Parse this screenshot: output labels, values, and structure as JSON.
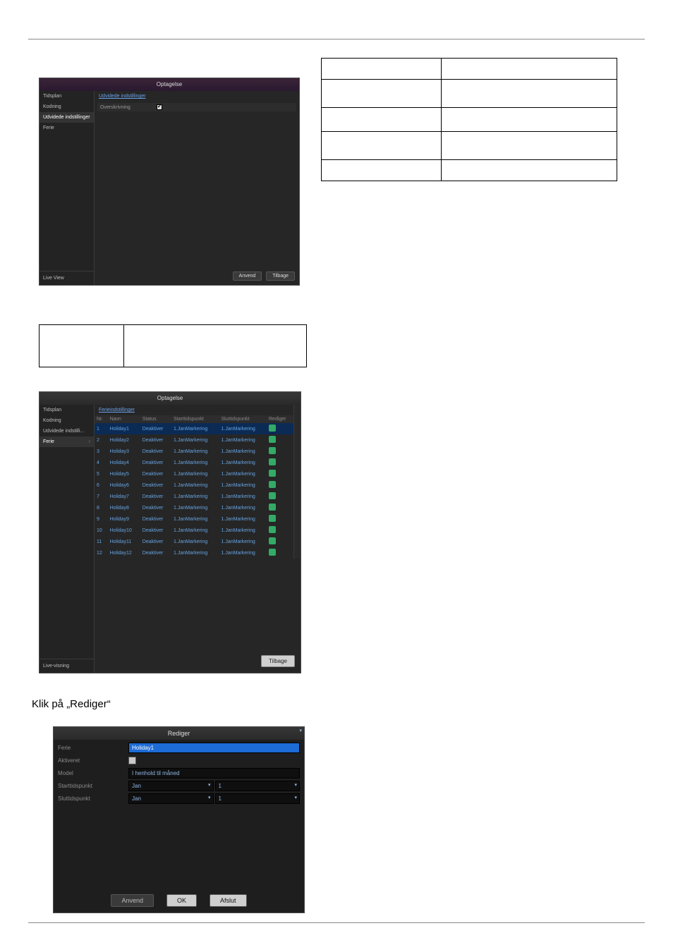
{
  "shot1": {
    "title": "Optagelse",
    "sidebar": [
      "Tidsplan",
      "Kodning",
      "Udvidede indstillinger",
      "Ferie"
    ],
    "sidebar_selected": 2,
    "live": "Live View",
    "tab": "Udvidede indstillinger",
    "row_label": "Overskrivning",
    "buttons": {
      "apply": "Anvend",
      "back": "Tilbage"
    }
  },
  "shot2": {
    "title": "Optagelse",
    "sidebar": [
      "Tidsplan",
      "Kodning",
      "Udvidede indstilli...",
      "Ferie"
    ],
    "sidebar_selected": 3,
    "live": "Live-visning",
    "tab": "Ferieindstillinger",
    "columns": [
      "Nr.",
      "Navn",
      "Status",
      "Starttidspunkt",
      "Sluttidspunkt",
      "Rediger"
    ],
    "selected_row": 0,
    "rows": [
      {
        "nr": "1",
        "name": "Holiday1",
        "status": "Deaktiver",
        "start": "1.JanMarkering",
        "end": "1.JanMarkering"
      },
      {
        "nr": "2",
        "name": "Holiday2",
        "status": "Deaktiver",
        "start": "1.JanMarkering",
        "end": "1.JanMarkering"
      },
      {
        "nr": "3",
        "name": "Holiday3",
        "status": "Deaktiver",
        "start": "1.JanMarkering",
        "end": "1.JanMarkering"
      },
      {
        "nr": "4",
        "name": "Holiday4",
        "status": "Deaktiver",
        "start": "1.JanMarkering",
        "end": "1.JanMarkering"
      },
      {
        "nr": "5",
        "name": "Holiday5",
        "status": "Deaktiver",
        "start": "1.JanMarkering",
        "end": "1.JanMarkering"
      },
      {
        "nr": "6",
        "name": "Holiday6",
        "status": "Deaktiver",
        "start": "1.JanMarkering",
        "end": "1.JanMarkering"
      },
      {
        "nr": "7",
        "name": "Holiday7",
        "status": "Deaktiver",
        "start": "1.JanMarkering",
        "end": "1.JanMarkering"
      },
      {
        "nr": "8",
        "name": "Holiday8",
        "status": "Deaktiver",
        "start": "1.JanMarkering",
        "end": "1.JanMarkering"
      },
      {
        "nr": "9",
        "name": "Holiday9",
        "status": "Deaktiver",
        "start": "1.JanMarkering",
        "end": "1.JanMarkering"
      },
      {
        "nr": "10",
        "name": "Holiday10",
        "status": "Deaktiver",
        "start": "1.JanMarkering",
        "end": "1.JanMarkering"
      },
      {
        "nr": "11",
        "name": "Holiday11",
        "status": "Deaktiver",
        "start": "1.JanMarkering",
        "end": "1.JanMarkering"
      },
      {
        "nr": "12",
        "name": "Holiday12",
        "status": "Deaktiver",
        "start": "1.JanMarkering",
        "end": "1.JanMarkering"
      }
    ],
    "buttons": {
      "back": "Tilbage"
    }
  },
  "bodytext": "Klik på „Rediger“",
  "shot3": {
    "title": "Rediger",
    "fields": {
      "ferie_label": "Ferie",
      "ferie_value": "Holiday1",
      "aktiveret_label": "Aktiveret",
      "model_label": "Model",
      "model_value": "I henhold til måned",
      "start_label": "Starttidspunkt",
      "start_month": "Jan",
      "start_day": "1",
      "end_label": "Sluttidspunkt",
      "end_month": "Jan",
      "end_day": "1"
    },
    "buttons": {
      "apply": "Anvend",
      "ok": "OK",
      "cancel": "Afslut"
    }
  }
}
